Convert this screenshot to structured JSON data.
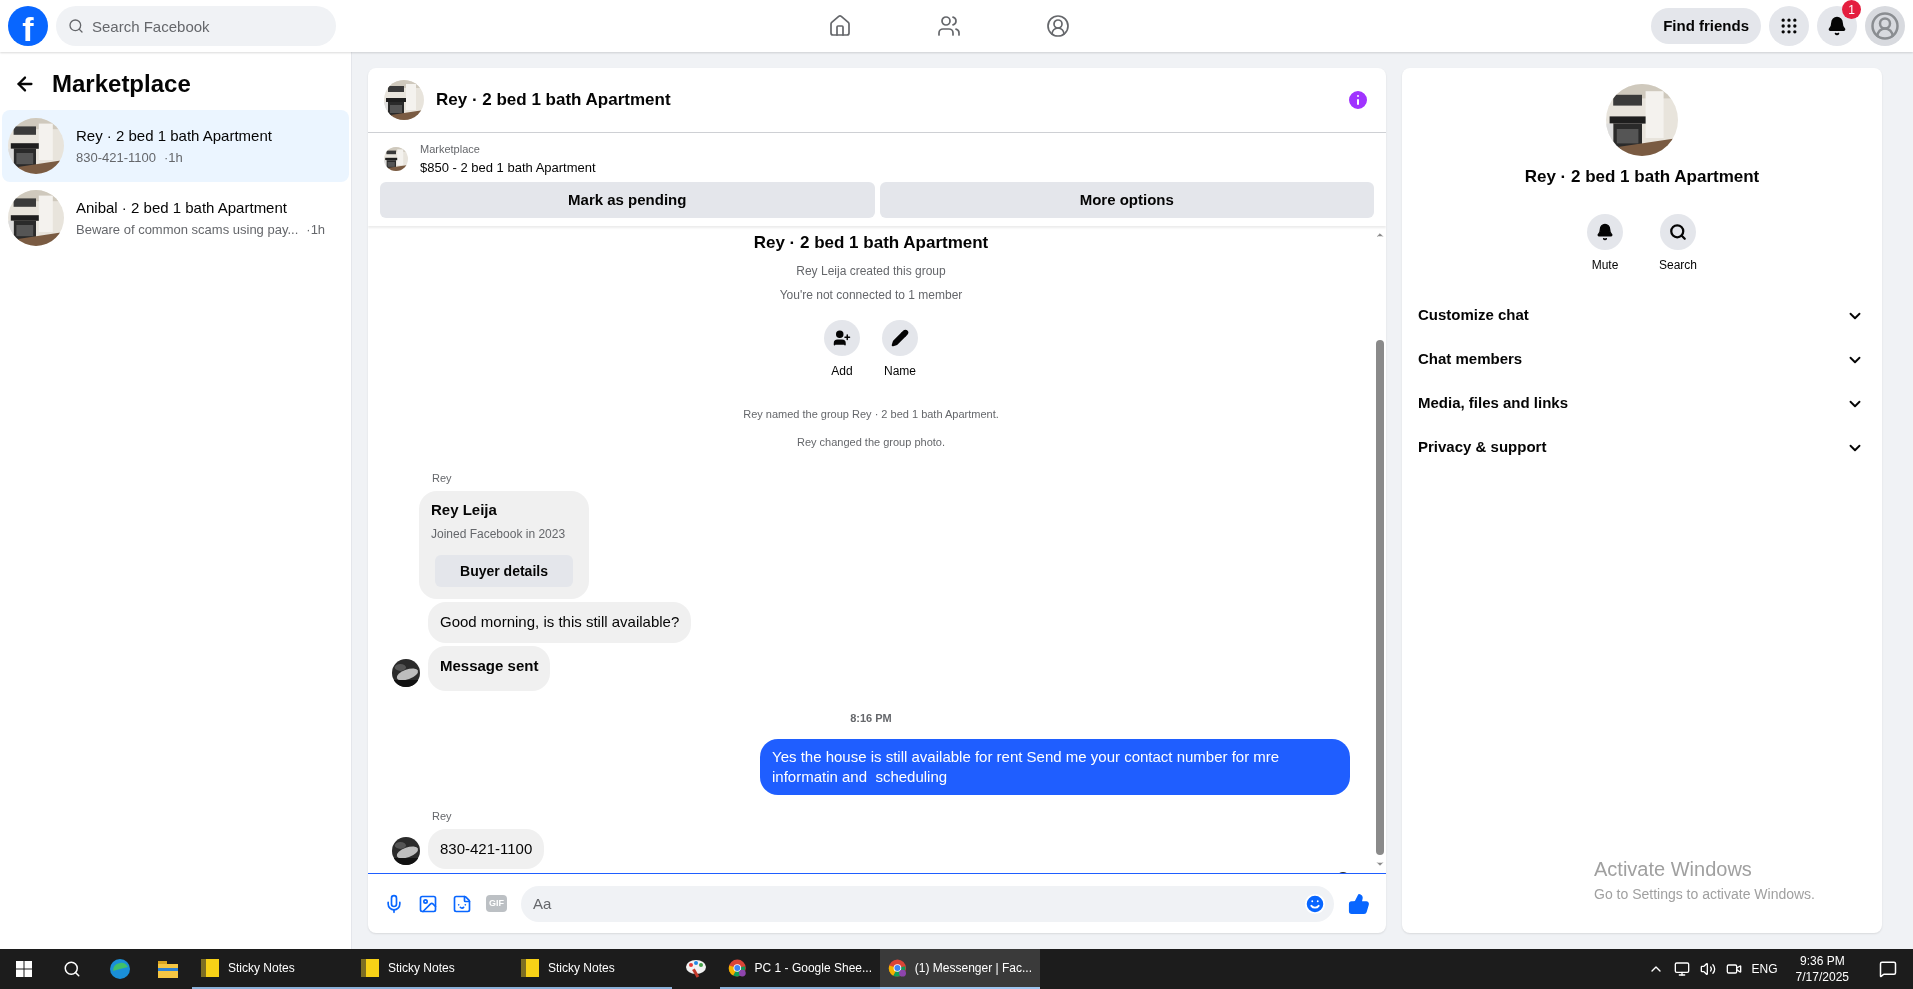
{
  "top_bar": {
    "logo": "f",
    "search_placeholder": "Search Facebook",
    "find_friends": "Find friends",
    "notification_count": "1"
  },
  "sidebar": {
    "title": "Marketplace",
    "conversations": [
      {
        "title": "Rey · 2 bed 1 bath Apartment",
        "preview": "830-421-1100",
        "time": "·1h",
        "selected": true
      },
      {
        "title": "Anibal · 2 bed 1 bath Apartment",
        "preview": "Beware of common scams using pay...",
        "time": "·1h",
        "selected": false
      }
    ]
  },
  "chat": {
    "title": "Rey · 2 bed 1 bath Apartment",
    "listing": {
      "label": "Marketplace",
      "text": "$850 - 2 bed 1 bath Apartment"
    },
    "actions": [
      "Mark as pending",
      "More options"
    ],
    "intro": {
      "title": "Rey · 2 bed 1 bath Apartment",
      "lines": [
        "Rey Leija created this group",
        "You're not connected to 1 member"
      ],
      "actions": [
        {
          "kind": "add",
          "label": "Add"
        },
        {
          "kind": "name",
          "label": "Name"
        }
      ]
    },
    "messages": [
      {
        "kind": "system",
        "text": "Rey named the group Rey · 2 bed 1 bath Apartment."
      },
      {
        "kind": "system",
        "text": "Rey changed the group photo."
      },
      {
        "kind": "sender",
        "text": "Rey"
      },
      {
        "kind": "card",
        "name": "Rey Leija",
        "text": "Joined Facebook in 2023",
        "button": "Buyer details"
      },
      {
        "kind": "incoming",
        "text": "Good morning, is this still available?",
        "avatar": false,
        "bold": false
      },
      {
        "kind": "incoming",
        "text": "Message sent",
        "avatar": true,
        "bold": true
      },
      {
        "kind": "timestamp",
        "text": "8:16 PM"
      },
      {
        "kind": "outgoing",
        "text": "Yes the house is still available for rent Send me your contact number for mre informatin and  scheduling"
      },
      {
        "kind": "sender",
        "text": "Rey"
      },
      {
        "kind": "incoming",
        "text": "830-421-1100",
        "avatar": true,
        "bold": false
      }
    ],
    "composer": {
      "placeholder": "Aa",
      "gif": "GIF"
    }
  },
  "details": {
    "title": "Rey · 2 bed 1 bath Apartment",
    "actions": [
      {
        "kind": "mute",
        "label": "Mute"
      },
      {
        "kind": "search",
        "label": "Search"
      }
    ],
    "sections": [
      {
        "label": "Customize chat",
        "expanded": false
      },
      {
        "label": "Chat members",
        "expanded": false
      },
      {
        "label": "Media, files and links",
        "expanded": false
      },
      {
        "label": "Privacy & support",
        "expanded": false
      }
    ]
  },
  "activation": {
    "title": "Activate Windows",
    "text": "Go to Settings to activate Windows."
  },
  "taskbar": {
    "pinned": [
      {
        "kind": "edge"
      },
      {
        "kind": "explorer"
      }
    ],
    "apps": [
      {
        "kind": "sticky",
        "label": "Sticky Notes",
        "selected": false
      },
      {
        "kind": "sticky",
        "label": "Sticky Notes",
        "selected": false
      },
      {
        "kind": "sticky",
        "label": "Sticky Notes",
        "selected": false
      },
      {
        "kind": "paint",
        "selected": false
      },
      {
        "kind": "chrome",
        "label": "PC 1 - Google Shee...",
        "selected": false
      },
      {
        "kind": "chrome",
        "label": "(1) Messenger | Fac...",
        "selected": true
      }
    ],
    "language": "ENG",
    "time": "9:36 PM",
    "date": "7/17/2025"
  }
}
